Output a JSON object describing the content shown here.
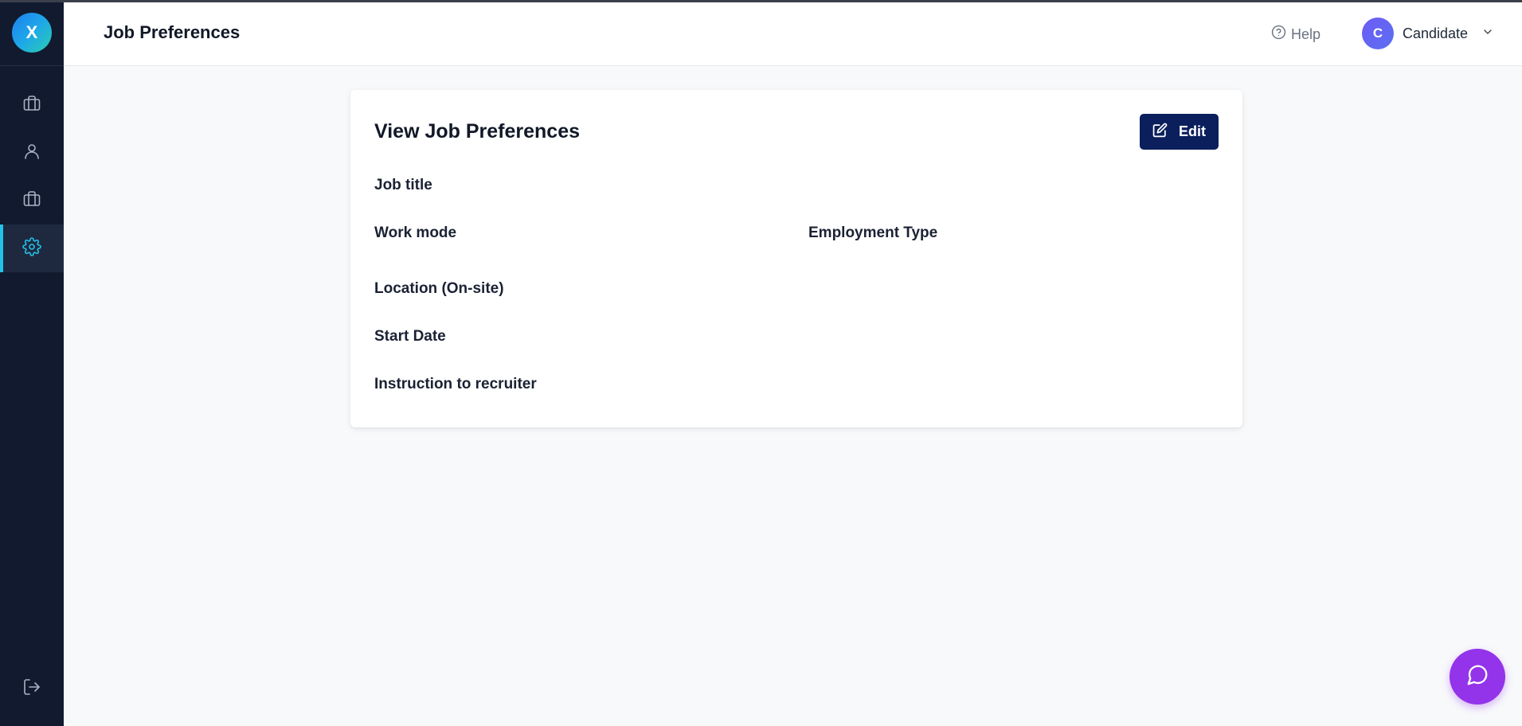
{
  "brand": {
    "logo_letter": "X"
  },
  "sidebar": {
    "items": [
      {
        "icon": "briefcase-icon",
        "active": false
      },
      {
        "icon": "user-icon",
        "active": false
      },
      {
        "icon": "briefcase-icon",
        "active": false
      },
      {
        "icon": "gear-icon",
        "active": true
      }
    ],
    "logout_icon": "logout-icon"
  },
  "header": {
    "title": "Job Preferences",
    "help_label": "Help",
    "user": {
      "initial": "C",
      "name": "Candidate"
    }
  },
  "card": {
    "title": "View Job Preferences",
    "edit_label": "Edit",
    "fields": {
      "job_title": "Job title",
      "work_mode": "Work mode",
      "employment_type": "Employment Type",
      "location": "Location (On-site)",
      "start_date": "Start Date",
      "instruction": "Instruction to recruiter"
    }
  },
  "colors": {
    "sidebar_bg": "#111a2e",
    "active_accent": "#22c3e6",
    "edit_button_bg": "#0b1f5c",
    "chat_button_bg": "#9333ea",
    "avatar_bg": "#6d5cf6"
  }
}
